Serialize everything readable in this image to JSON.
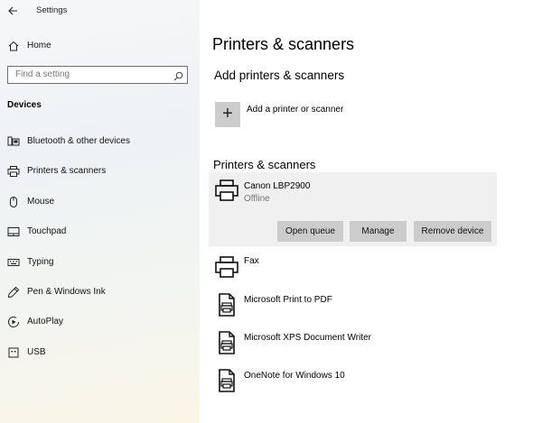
{
  "window": {
    "title": "Settings"
  },
  "sidebar": {
    "home_label": "Home",
    "search": {
      "placeholder": "Find a setting",
      "value": ""
    },
    "section_title": "Devices",
    "items": [
      {
        "label": "Bluetooth & other devices",
        "icon": "bluetooth-devices-icon"
      },
      {
        "label": "Printers & scanners",
        "icon": "printer-icon"
      },
      {
        "label": "Mouse",
        "icon": "mouse-icon"
      },
      {
        "label": "Touchpad",
        "icon": "touchpad-icon"
      },
      {
        "label": "Typing",
        "icon": "keyboard-icon"
      },
      {
        "label": "Pen & Windows Ink",
        "icon": "pen-icon"
      },
      {
        "label": "AutoPlay",
        "icon": "autoplay-icon"
      },
      {
        "label": "USB",
        "icon": "usb-icon"
      }
    ]
  },
  "main": {
    "title": "Printers & scanners",
    "add_section": {
      "title": "Add printers & scanners",
      "add_label": "Add a printer or scanner"
    },
    "list_title": "Printers & scanners",
    "printers": [
      {
        "name": "Canon LBP2900",
        "status": "Offline",
        "icon": "printer-icon",
        "selected": true
      },
      {
        "name": "Fax",
        "icon": "fax-printer-icon"
      },
      {
        "name": "Microsoft Print to PDF",
        "icon": "document-printer-icon"
      },
      {
        "name": "Microsoft XPS Document Writer",
        "icon": "document-printer-icon"
      },
      {
        "name": "OneNote for Windows 10",
        "icon": "document-printer-icon"
      }
    ],
    "actions": {
      "open_queue": "Open queue",
      "manage": "Manage",
      "remove": "Remove device"
    }
  }
}
